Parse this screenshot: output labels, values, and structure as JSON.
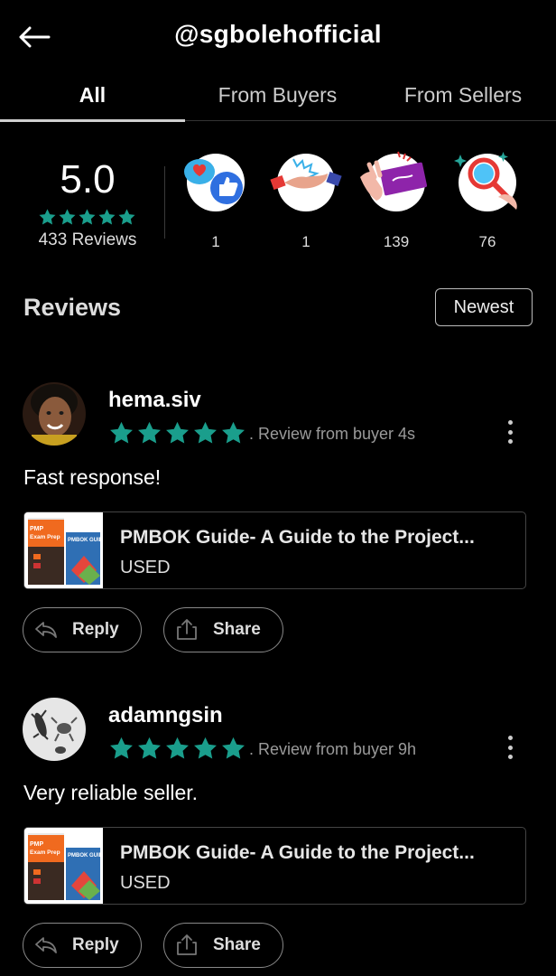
{
  "header": {
    "title": "@sgbolehofficial"
  },
  "tabs": [
    {
      "label": "All",
      "active": true
    },
    {
      "label": "From Buyers",
      "active": false
    },
    {
      "label": "From Sellers",
      "active": false
    }
  ],
  "summary": {
    "score": "5.0",
    "stars": 5,
    "review_count": "433 Reviews",
    "badges": [
      {
        "icon": "like-heart-icon",
        "count": "1"
      },
      {
        "icon": "handshake-icon",
        "count": "1"
      },
      {
        "icon": "gift-card-icon",
        "count": "139"
      },
      {
        "icon": "magnifier-icon",
        "count": "76"
      }
    ]
  },
  "reviews_section": {
    "title": "Reviews",
    "sort_label": "Newest"
  },
  "reviews": [
    {
      "username": "hema.siv",
      "stars": 5,
      "meta": ". Review from buyer  4s",
      "text": "Fast response!",
      "product": {
        "title": "PMBOK Guide- A Guide to the Project...",
        "condition": "USED"
      },
      "reply_label": "Reply",
      "share_label": "Share"
    },
    {
      "username": "adamngsin",
      "stars": 5,
      "meta": ". Review from buyer  9h",
      "text": "Very reliable seller.",
      "product": {
        "title": "PMBOK Guide- A Guide to the Project...",
        "condition": "USED"
      },
      "reply_label": "Reply",
      "share_label": "Share"
    }
  ],
  "colors": {
    "star": "#1a9e8c",
    "background": "#000000"
  }
}
